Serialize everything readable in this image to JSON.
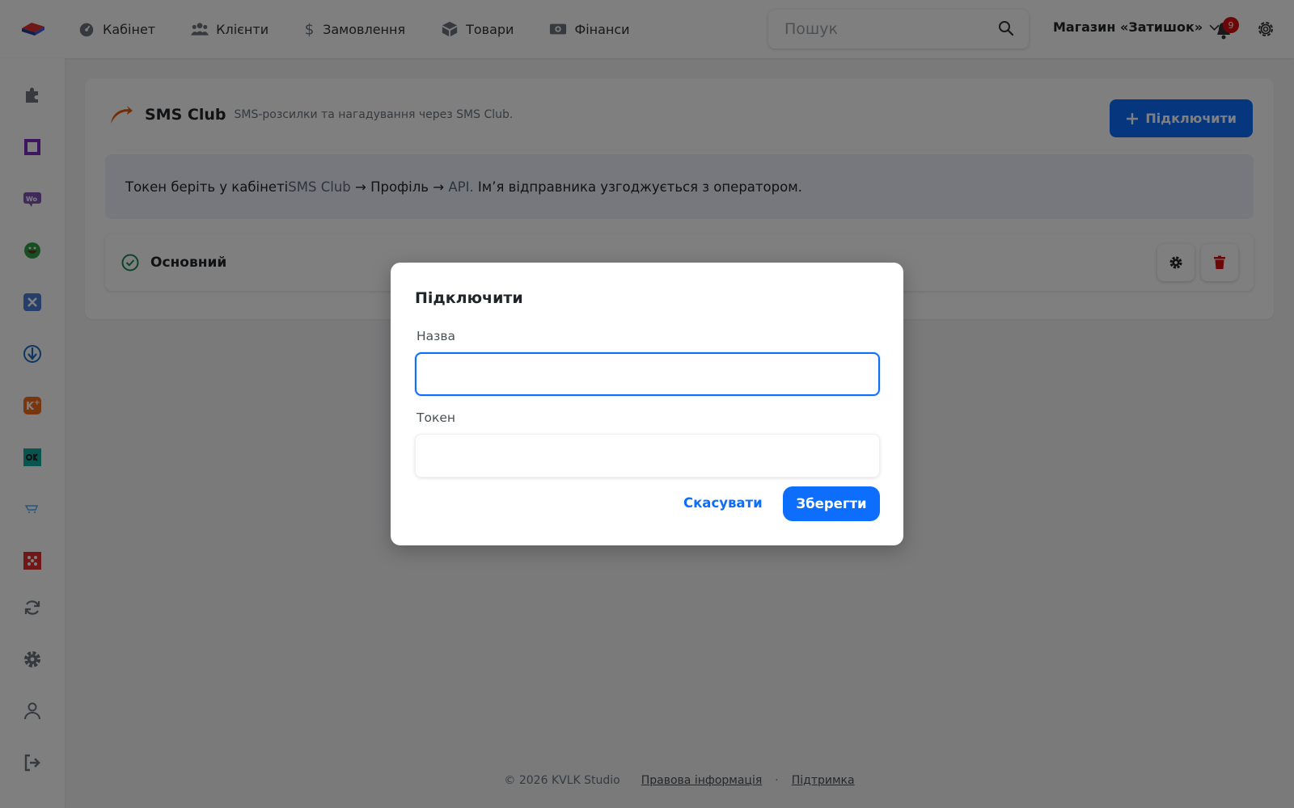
{
  "nav": {
    "items": [
      {
        "label": "Кабінет",
        "icon": "dashboard-icon"
      },
      {
        "label": "Клієнти",
        "icon": "users-icon"
      },
      {
        "label": "Замовлення",
        "icon": "dollar-icon"
      },
      {
        "label": "Товари",
        "icon": "box-icon"
      },
      {
        "label": "Фінанси",
        "icon": "money-icon"
      }
    ]
  },
  "search": {
    "placeholder": "Пошук"
  },
  "store": {
    "name": "Магазин «Затишок»"
  },
  "notifications": {
    "count": "9"
  },
  "sidebar": {
    "icons": [
      "puzzle-icon",
      "square-icon",
      "woo-icon",
      "green-circle-icon",
      "x-app-icon",
      "arrow-down-circle-icon",
      "k-plus-icon",
      "ok-icon",
      "cart-icon",
      "grid-icon",
      "sync-icon",
      "gear-icon",
      "user-icon",
      "logout-icon"
    ]
  },
  "integration": {
    "title": "SMS Club",
    "subtitle": "SMS-розсилки та нагадування через SMS Club.",
    "connect_label": "Підключити",
    "info": {
      "part1": "Токен беріть у кабінеті ",
      "part2": "SMS Club",
      "part3": " → Профіль → ",
      "part4": "API.",
      "part5": " Ім’я відправника узгоджується з оператором."
    },
    "account": {
      "name": "Основний"
    }
  },
  "footer": {
    "copyright": "© 2026 KVLK Studio",
    "legal": "Правова інформація",
    "separator": "·",
    "support": "Підтримка"
  },
  "modal": {
    "title": "Підключити",
    "name_label": "Назва",
    "name_value": "",
    "token_label": "Токен",
    "token_value": "",
    "cancel_label": "Скасувати",
    "save_label": "Зберегти"
  },
  "colors": {
    "accent": "#0d6efd",
    "danger": "#d90f0f",
    "success": "#198754"
  }
}
